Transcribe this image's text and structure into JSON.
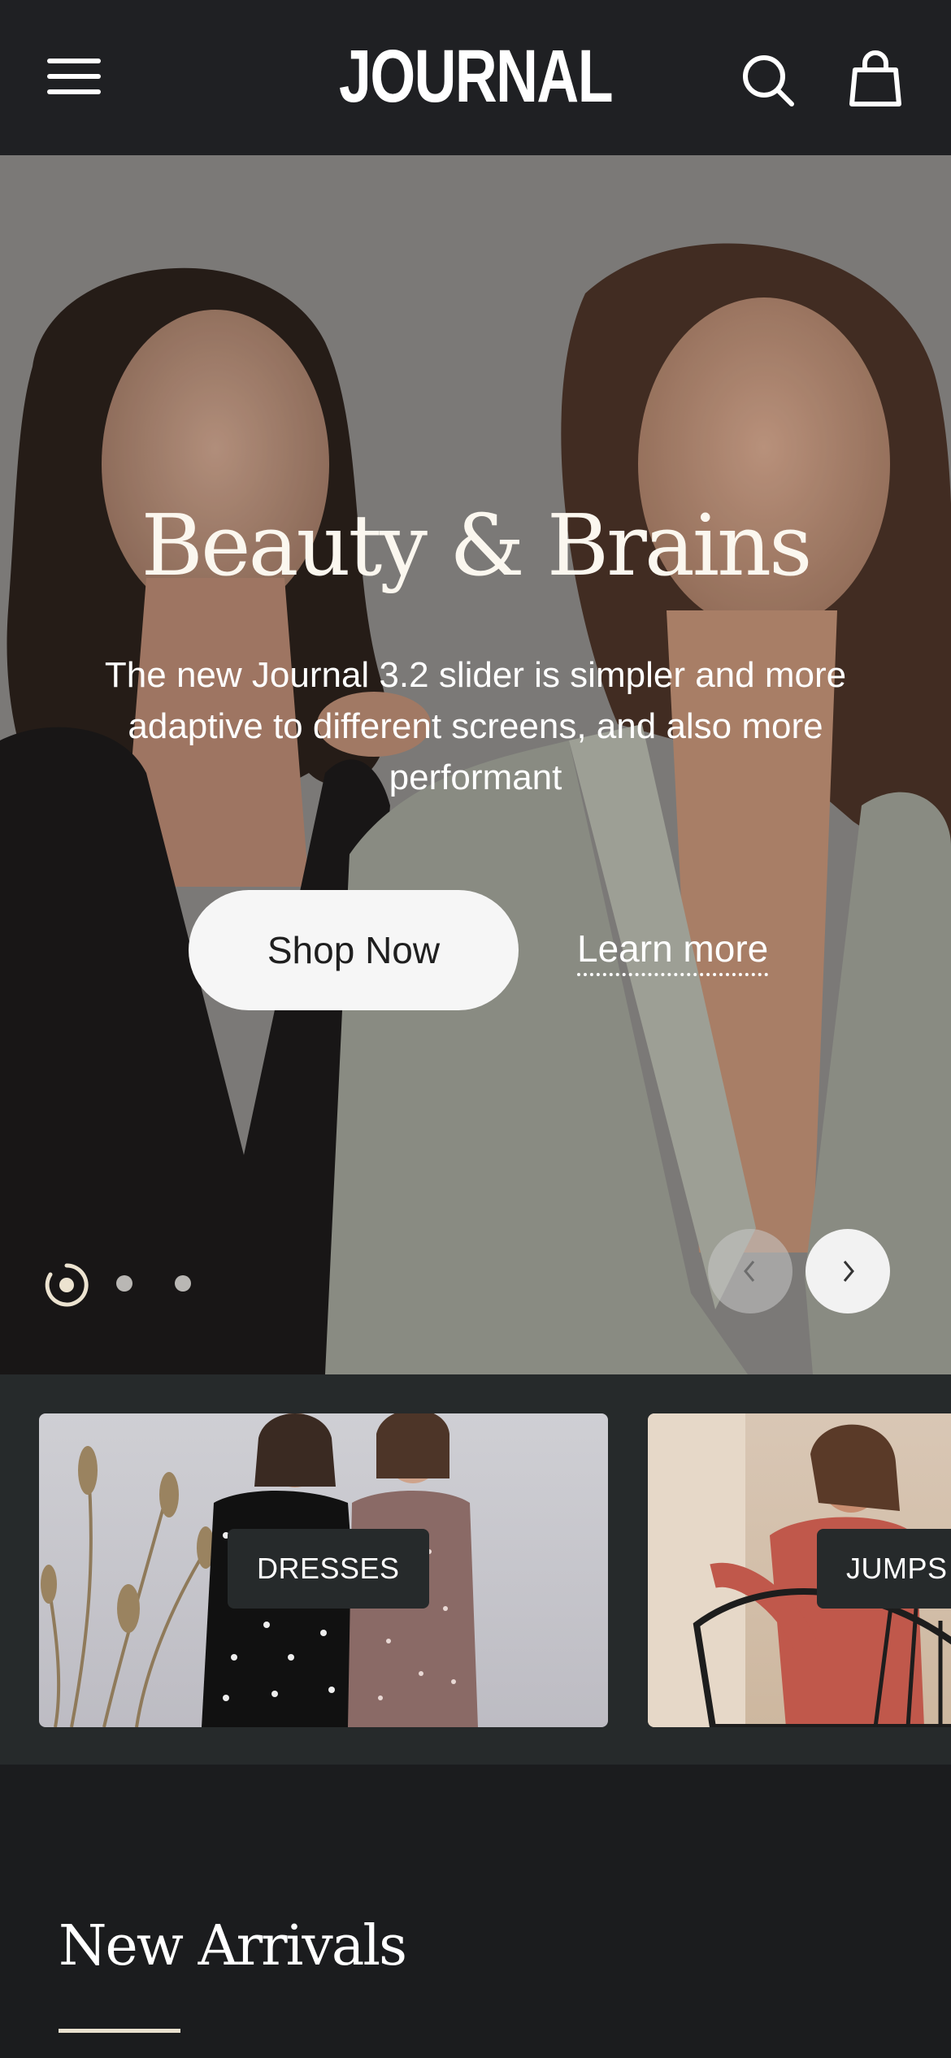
{
  "header": {
    "logo_text": "JOURNAL",
    "menu_icon": "hamburger-menu-icon",
    "search_icon": "search-icon",
    "cart_icon": "shopping-bag-icon"
  },
  "hero": {
    "title": "Beauty & Brains",
    "text": "The new Journal 3.2 slider is simpler and more adaptive to different screens, and also more performant",
    "primary_button": "Shop Now",
    "secondary_link": "Learn more",
    "slide_count": 3,
    "active_slide": 1,
    "prev_icon": "chevron-left-icon",
    "next_icon": "chevron-right-icon"
  },
  "categories": [
    {
      "label": "DRESSES"
    },
    {
      "label": "JUMPS"
    }
  ],
  "new_arrivals": {
    "title": "New Arrivals"
  },
  "colors": {
    "header_bg": "#1f2023",
    "page_bg": "#1b1c1e",
    "strip_bg": "#262a2b",
    "accent_line": "#e9e1cf",
    "button_bg": "#f6f6f6"
  }
}
